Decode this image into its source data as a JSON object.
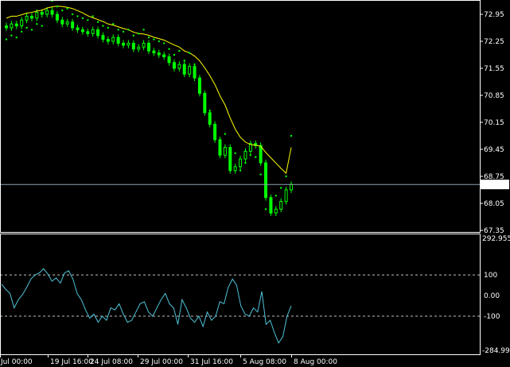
{
  "main_panel": {
    "price_axis": [
      "72.95",
      "72.25",
      "71.55",
      "70.85",
      "70.15",
      "69.45",
      "68.75",
      "68.05",
      "67.35"
    ],
    "current_price": "68.54"
  },
  "indicator_panel": {
    "scale_top": "292.955",
    "levels": [
      "100",
      "0.00",
      "-100"
    ],
    "scale_bottom": "-284.999"
  },
  "time_axis": [
    "Jul 00:00",
    "19 Jul 16:00",
    "24 Jul 08:00",
    "29 Jul 00:00",
    "31 Jul 16:00",
    "5 Aug 08:00",
    "8 Aug 00:00"
  ],
  "colors": {
    "background": "#000000",
    "candles": "#00ff00",
    "parabolic_sar": "#00ff00",
    "moving_average": "#ffff00",
    "cci_line": "#4fc3d9",
    "price_line": "#8da2b0",
    "axis_text": "#ffffff"
  },
  "chart_data": [
    {
      "type": "candlestick",
      "title": "",
      "y_range": [
        67.35,
        72.95
      ],
      "closes": [
        72.6,
        72.7,
        72.65,
        72.8,
        72.9,
        72.85,
        73.0,
        72.95,
        73.05,
        72.95,
        72.8,
        72.7,
        72.75,
        72.6,
        72.55,
        72.5,
        72.45,
        72.55,
        72.4,
        72.3,
        72.25,
        72.35,
        72.2,
        72.15,
        72.2,
        72.05,
        72.1,
        72.2,
        72.0,
        71.95,
        71.9,
        71.85,
        71.7,
        71.55,
        71.65,
        71.4,
        71.6,
        71.3,
        70.9,
        70.4,
        70.1,
        69.7,
        69.3,
        69.5,
        68.9,
        69.0,
        69.2,
        69.4,
        69.6,
        69.55,
        69.1,
        68.2,
        67.8,
        67.9,
        68.1,
        68.4,
        68.54
      ],
      "moving_average_last": 69.5,
      "parabolic_sar_last": 69.8
    },
    {
      "type": "line",
      "title": "",
      "y_range": [
        -284.999,
        292.955
      ],
      "levels": [
        100,
        0,
        -100
      ],
      "values": [
        55,
        30,
        10,
        -60,
        -20,
        5,
        40,
        80,
        100,
        110,
        130,
        105,
        70,
        85,
        60,
        110,
        120,
        80,
        10,
        -20,
        -70,
        -110,
        -90,
        -130,
        -100,
        -120,
        -60,
        -70,
        -40,
        -90,
        -130,
        -120,
        -80,
        -40,
        -30,
        -80,
        -100,
        -60,
        -20,
        10,
        -40,
        -60,
        -140,
        -20,
        -60,
        -110,
        -130,
        -100,
        -150,
        -80,
        -120,
        -100,
        -30,
        -40,
        40,
        80,
        50,
        -50,
        -90,
        -100,
        -60,
        -80,
        20,
        -140,
        -120,
        -180,
        -230,
        -200,
        -100,
        -50
      ]
    }
  ]
}
